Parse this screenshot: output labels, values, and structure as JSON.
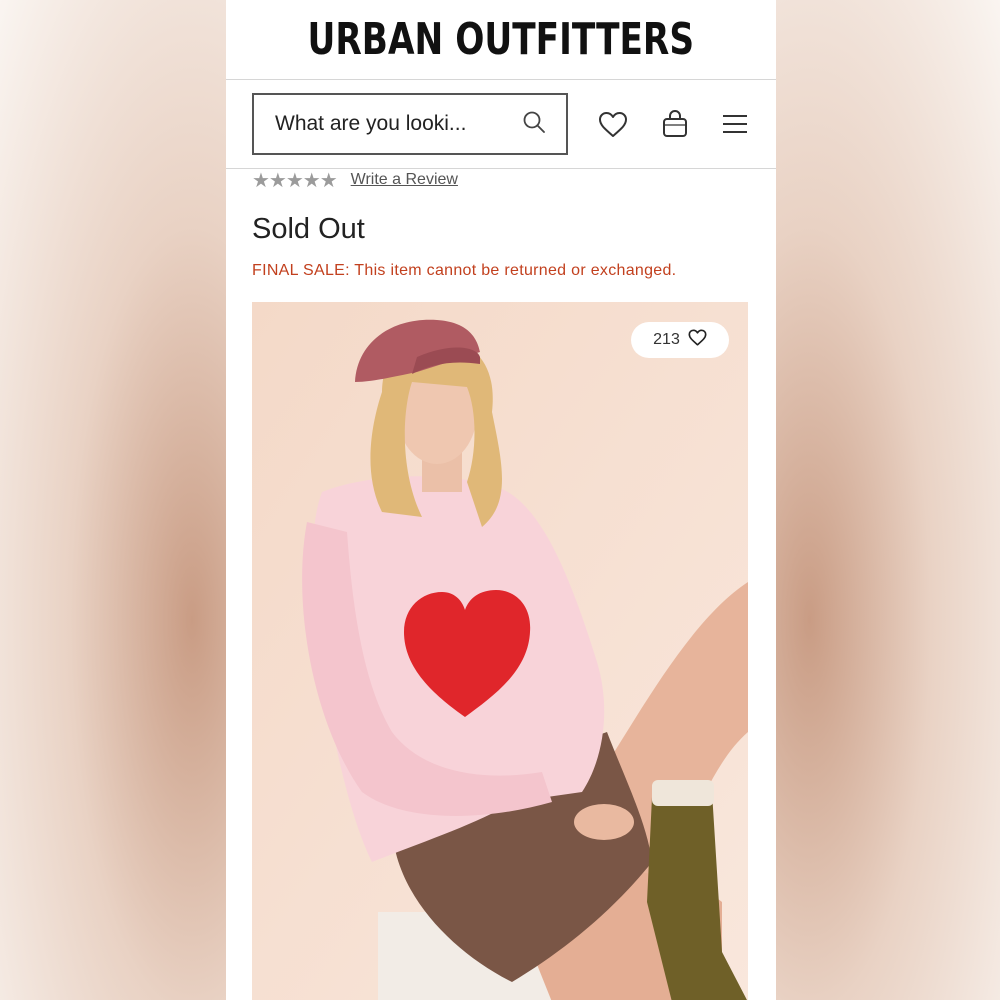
{
  "brand": {
    "name": "URBAN OUTFITTERS"
  },
  "header": {
    "search": {
      "placeholder": "What are you looki..."
    },
    "icons": [
      "search-icon",
      "heart-icon",
      "shopping-bag-icon",
      "hamburger-menu-icon"
    ]
  },
  "product": {
    "rating": {
      "stars_filled": 0,
      "stars_total": 5,
      "stars": "★★★★★"
    },
    "review_link": "Write a Review",
    "status": "Sold Out",
    "final_sale_notice": "FINAL SALE: This item cannot be returned or exchanged.",
    "image": {
      "like_count": "213",
      "description_icon": "heart-icon"
    }
  },
  "colors": {
    "final_sale": "#c2401e",
    "star_empty": "#9b9b9b",
    "image_bg": "#f6dfd0",
    "sweater": "#f7cfd6",
    "heart": "#e0262b"
  }
}
